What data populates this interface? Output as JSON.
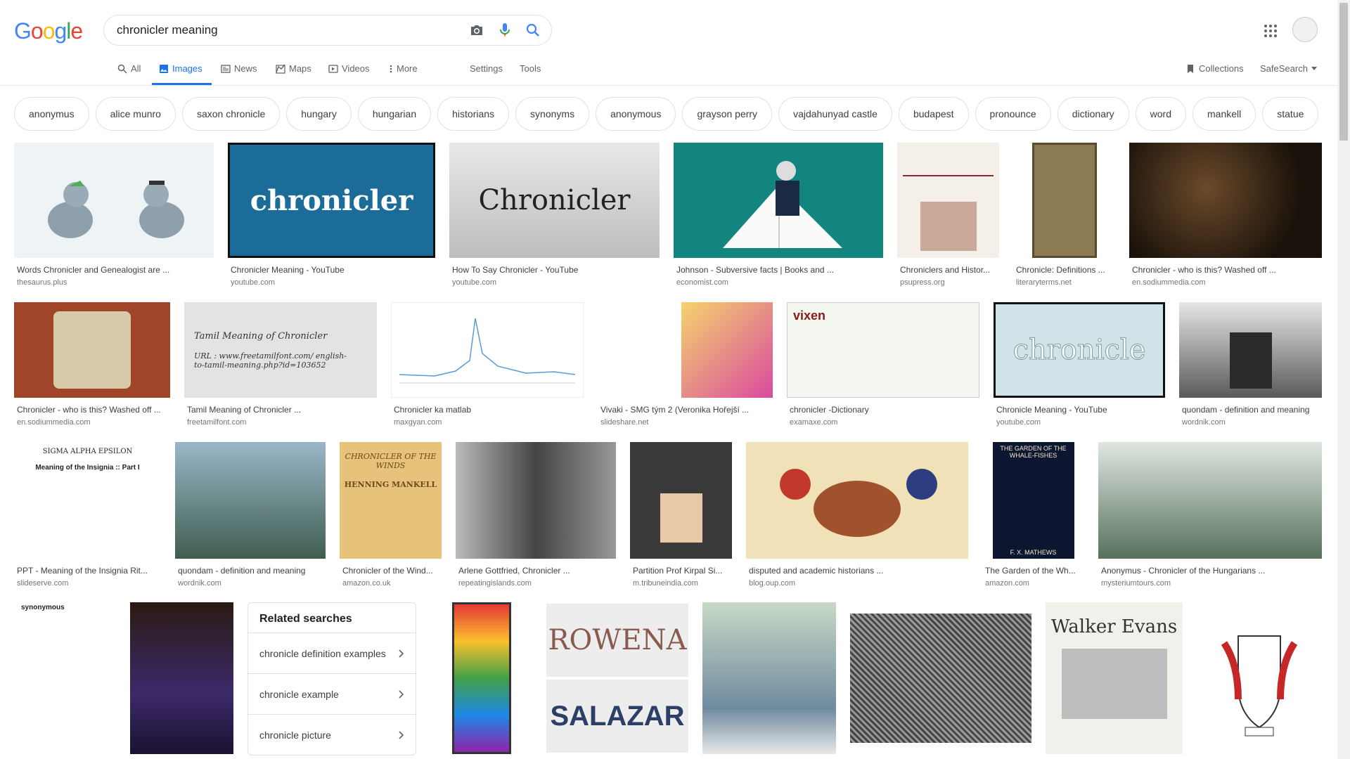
{
  "search": {
    "query": "chronicler meaning"
  },
  "tabs": [
    {
      "label": "All",
      "icon": "search-icon"
    },
    {
      "label": "Images",
      "icon": "image-icon",
      "active": true
    },
    {
      "label": "News",
      "icon": "news-icon"
    },
    {
      "label": "Maps",
      "icon": "map-icon"
    },
    {
      "label": "Videos",
      "icon": "video-icon"
    },
    {
      "label": "More",
      "icon": "more-vert-icon"
    },
    {
      "label": "Settings"
    },
    {
      "label": "Tools"
    }
  ],
  "right_tools": {
    "collections": "Collections",
    "safesearch": "SafeSearch"
  },
  "chips": [
    "anonymus",
    "alice munro",
    "saxon chronicle",
    "hungary",
    "hungarian",
    "historians",
    "synonyms",
    "anonymous",
    "grayson perry",
    "vajdahunyad castle",
    "budapest",
    "pronounce",
    "dictionary",
    "word",
    "mankell",
    "statue"
  ],
  "results": [
    {
      "caption": "Words Chronicler and Genealogist are ...",
      "source": "thesaurus.plus"
    },
    {
      "caption": "Chronicler Meaning - YouTube",
      "source": "youtube.com",
      "overlay": "chronicler"
    },
    {
      "caption": "How To Say Chronicler - YouTube",
      "source": "youtube.com",
      "overlay": "Chronicler"
    },
    {
      "caption": "Johnson - Subversive facts | Books and ...",
      "source": "economist.com"
    },
    {
      "caption": "Chroniclers and Histor...",
      "source": "psupress.org"
    },
    {
      "caption": "Chronicle: Definitions ...",
      "source": "literaryterms.net"
    },
    {
      "caption": "Chronicler - who is this? Washed off ...",
      "source": "en.sodiummedia.com"
    },
    {
      "caption": "Chronicler - who is this? Washed off ...",
      "source": "en.sodiummedia.com"
    },
    {
      "caption": "Tamil Meaning of Chronicler ...",
      "source": "freetamilfont.com",
      "overlay": "Tamil Meaning of Chronicler",
      "overlay2": "URL : www.freetamilfont.com/ english-to-tamil-meaning.php?id=103652"
    },
    {
      "caption": "Chronicler ka matlab",
      "source": "maxgyan.com"
    },
    {
      "caption": "Vivaki - SMG tým 2 (Veronika Hořejší ...",
      "source": "slideshare.net"
    },
    {
      "caption": "chronicler -Dictionary",
      "source": "examaxe.com",
      "overlay": "vixen"
    },
    {
      "caption": "Chronicle Meaning - YouTube",
      "source": "youtube.com",
      "overlay": "chronicle"
    },
    {
      "caption": "quondam - definition and meaning",
      "source": "wordnik.com"
    },
    {
      "caption": "PPT - Meaning of the Insignia Rit...",
      "source": "slideserve.com",
      "overlay": "SIGMA ALPHA EPSILON",
      "overlay2": "Meaning of the Insignia :: Part I"
    },
    {
      "caption": "quondam - definition and meaning",
      "source": "wordnik.com"
    },
    {
      "caption": "Chronicler of the Wind...",
      "source": "amazon.co.uk",
      "overlay": "CHRONICLER OF THE WINDS",
      "overlay2": "HENNING MANKELL"
    },
    {
      "caption": "Arlene Gottfried, Chronicler ...",
      "source": "repeatingislands.com"
    },
    {
      "caption": "Partition Prof Kirpal Si...",
      "source": "m.tribuneindia.com"
    },
    {
      "caption": "disputed and academic historians ...",
      "source": "blog.oup.com"
    },
    {
      "caption": "The Garden of the Wh...",
      "source": "amazon.com",
      "overlay": "THE GARDEN OF THE WHALE-FISHES",
      "overlay2": "F. X. MATHEWS"
    },
    {
      "caption": "Anonymus - Chronicler of the Hungarians ...",
      "source": "mysteriumtours.com"
    }
  ],
  "row4_overlays": {
    "synonymous": "synonymous",
    "rowena": "ROWENA",
    "salazar": "SALAZAR",
    "walker": "Walker Evans"
  },
  "related": {
    "title": "Related searches",
    "items": [
      "chronicle definition examples",
      "chronicle example",
      "chronicle picture"
    ]
  },
  "colors": {
    "blue": "#4285F4",
    "red": "#EA4335",
    "yellow": "#FBBC05",
    "green": "#34A853",
    "link": "#1a73e8"
  }
}
